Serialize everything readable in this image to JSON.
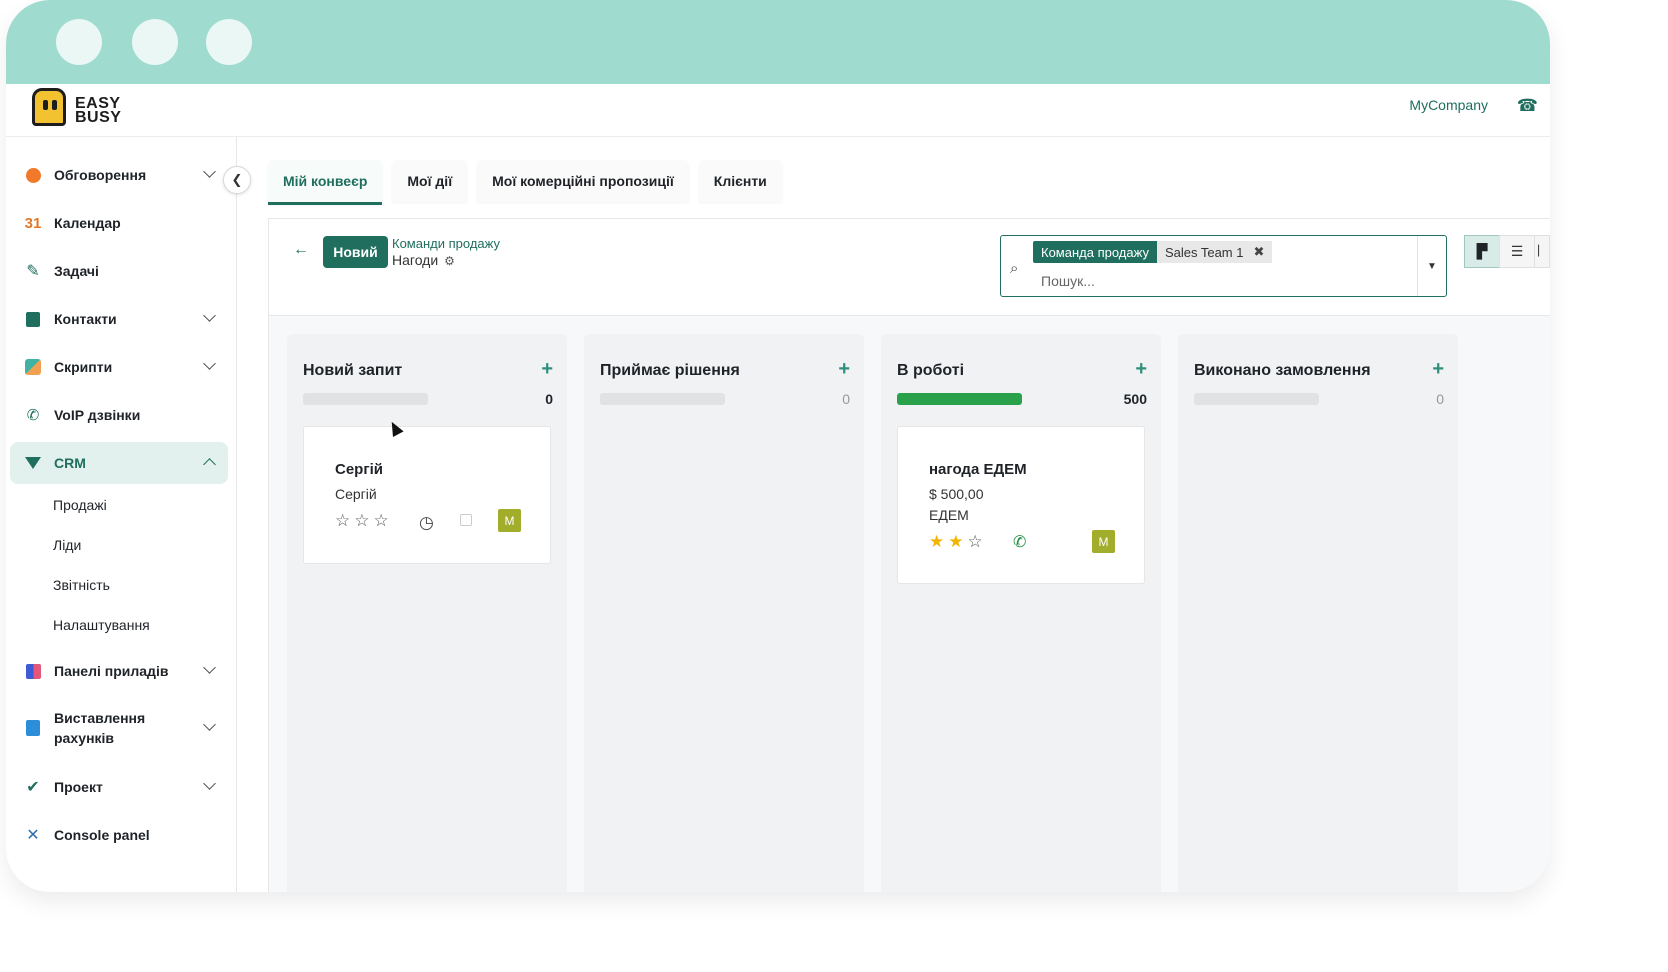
{
  "header": {
    "logo_line1": "EASY",
    "logo_line2": "BUSY",
    "company": "MyCompany",
    "phone_icon": "phone-icon"
  },
  "sidebar": {
    "items": [
      {
        "label": "Обговорення",
        "icon": "chat-icon"
      },
      {
        "label": "Календар",
        "icon": "calendar-icon",
        "icon_text": "31"
      },
      {
        "label": "Задачі",
        "icon": "pen-icon"
      },
      {
        "label": "Контакти",
        "icon": "contacts-icon"
      },
      {
        "label": "Скрипти",
        "icon": "scripts-icon"
      },
      {
        "label": "VoIP дзвінки",
        "icon": "phone-icon"
      },
      {
        "label": "CRM",
        "icon": "crm-icon"
      },
      {
        "label": "Панелі приладів",
        "icon": "dashboard-icon"
      },
      {
        "label": "Виставлення рахунків",
        "icon": "invoice-icon"
      },
      {
        "label": "Проект",
        "icon": "check-icon"
      },
      {
        "label": "Console panel",
        "icon": "tools-icon"
      }
    ],
    "crm_sub": [
      "Продажі",
      "Ліди",
      "Звітність",
      "Налаштування"
    ]
  },
  "tabs": [
    "Мій конвеєр",
    "Мої дії",
    "Мої комерційні пропозиції",
    "Клієнти"
  ],
  "control": {
    "new_label": "Новий",
    "breadcrumb_parent": "Команди продажу",
    "breadcrumb_current": "Нагоди",
    "facet_key": "Команда продажу",
    "facet_value": "Sales Team 1",
    "search_placeholder": "Пошук..."
  },
  "columns": [
    {
      "title": "Новий запит",
      "count": "0",
      "progress": 0
    },
    {
      "title": "Приймає рішення",
      "count": "0",
      "progress": 0
    },
    {
      "title": "В роботі",
      "count": "500",
      "progress": 1
    },
    {
      "title": "Виконано замовлення",
      "count": "0",
      "progress": 0
    }
  ],
  "cards": {
    "c1": {
      "title": "Сергій",
      "line1": "Сергій",
      "stars": 0,
      "avatar": "M"
    },
    "c2": {
      "title": "нагода ЕДЕМ",
      "line1": "$ 500,00",
      "line2": "ЕДЕМ",
      "stars": 2,
      "avatar": "M"
    }
  },
  "colors": {
    "accent": "#1f6e5e",
    "titlebar": "#a0dbd0",
    "progress": "#28a14a",
    "avatar": "#a3ad2c",
    "star": "#f3b400"
  }
}
